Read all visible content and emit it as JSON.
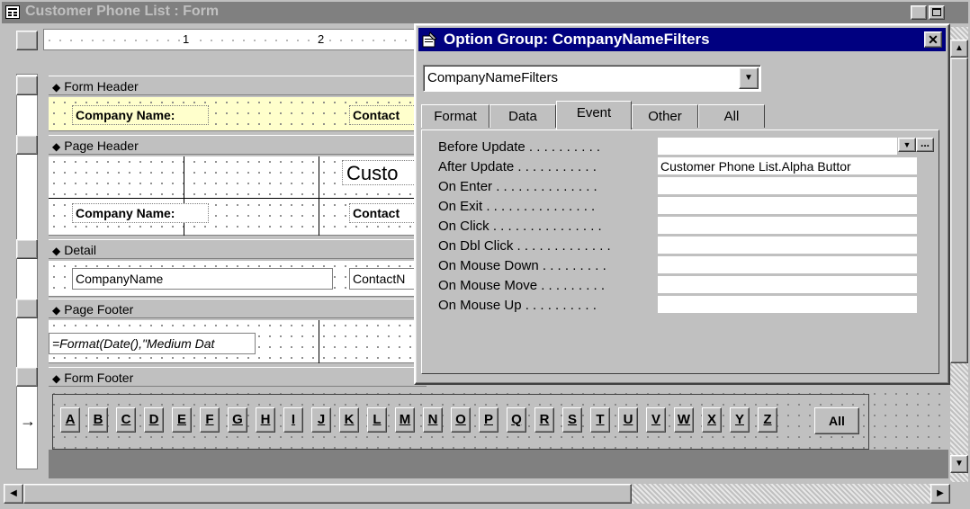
{
  "form_window": {
    "title": "Customer Phone List : Form",
    "ruler_marks": [
      "1",
      "2"
    ],
    "sections": {
      "form_header": "Form Header",
      "page_header": "Page Header",
      "detail": "Detail",
      "page_footer": "Page Footer",
      "form_footer": "Form Footer"
    },
    "form_header_controls": {
      "company_label": "Company Name:",
      "contact_label": "Contact"
    },
    "page_header_controls": {
      "title_label": "Custo",
      "company_label": "Company Name:",
      "contact_label": "Contact"
    },
    "detail_controls": {
      "company_field": "CompanyName",
      "contact_field": "ContactN"
    },
    "page_footer_controls": {
      "date_field": "=Format(Date(),\"Medium Dat"
    },
    "alpha_buttons": [
      "A",
      "B",
      "C",
      "D",
      "E",
      "F",
      "G",
      "H",
      "I",
      "J",
      "K",
      "L",
      "M",
      "N",
      "O",
      "P",
      "Q",
      "R",
      "S",
      "T",
      "U",
      "V",
      "W",
      "X",
      "Y",
      "Z"
    ],
    "all_button": "All"
  },
  "property_sheet": {
    "title": "Option Group: CompanyNameFilters",
    "object_select": "CompanyNameFilters",
    "tabs": [
      "Format",
      "Data",
      "Event",
      "Other",
      "All"
    ],
    "active_tab": "Event",
    "properties": [
      {
        "label": "Before Update . . . . . . . . . .",
        "value": ""
      },
      {
        "label": "After Update . . . . . . . . . . .",
        "value": "Customer Phone List.Alpha Buttor"
      },
      {
        "label": "On Enter . . . . . . . . . . . . . .",
        "value": ""
      },
      {
        "label": "On Exit . . . . . . . . . . . . . . .",
        "value": ""
      },
      {
        "label": "On Click . . . . . . . . . . . . . . .",
        "value": ""
      },
      {
        "label": "On Dbl Click . . . . . . . . . . . . .",
        "value": ""
      },
      {
        "label": "On Mouse Down . . . . . . . . .",
        "value": ""
      },
      {
        "label": "On Mouse Move . . . . . . . . .",
        "value": ""
      },
      {
        "label": "On Mouse Up . . . . . . . . . .",
        "value": ""
      }
    ],
    "builder_button": "..."
  },
  "icons": [
    "form-icon",
    "properties-icon",
    "close-icon",
    "minimize-icon",
    "maximize-icon",
    "dropdown-arrow-icon",
    "section-arrow-icon",
    "scroll-up-icon",
    "scroll-down-icon",
    "scroll-left-icon",
    "scroll-right-icon",
    "current-row-arrow-icon"
  ],
  "colors": {
    "title_bar_inactive": "#808080",
    "title_bar_active": "#000080",
    "header_fill": "#ffffcc"
  }
}
